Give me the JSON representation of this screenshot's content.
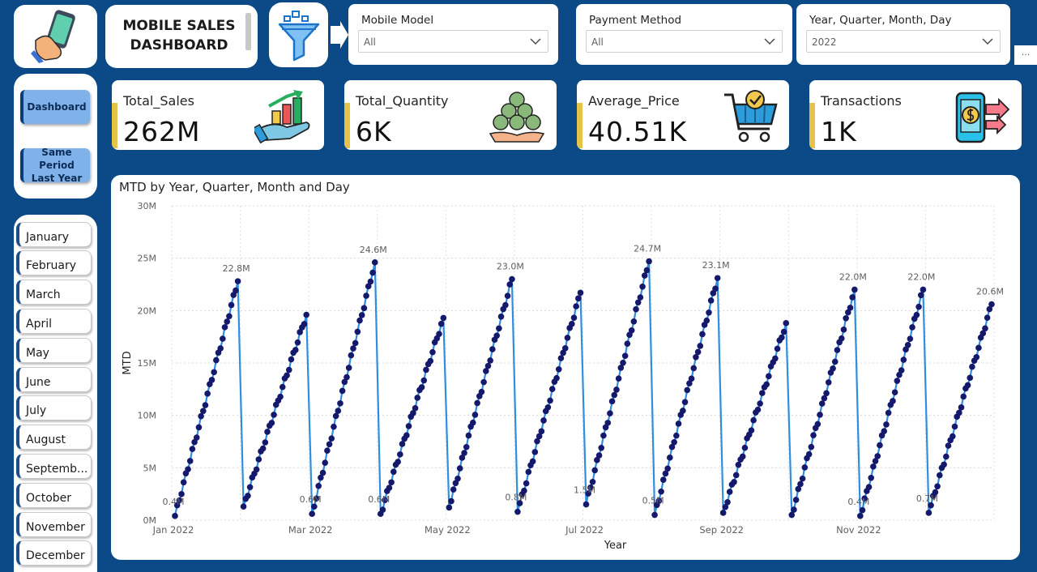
{
  "header": {
    "title_line1": "MOBILE SALES",
    "title_line2": "DASHBOARD"
  },
  "filters": [
    {
      "label": "Mobile Model",
      "value": "All"
    },
    {
      "label": "Payment Method",
      "value": "All"
    },
    {
      "label": "Year, Quarter, Month, Day",
      "value": "2022"
    }
  ],
  "more_label": "...",
  "nav": {
    "dashboard": "Dashboard",
    "same_period_line1": "Same Period",
    "same_period_line2": "Last Year"
  },
  "months": [
    "January",
    "February",
    "March",
    "April",
    "May",
    "June",
    "July",
    "August",
    "Septemb...",
    "October",
    "November",
    "December"
  ],
  "kpis": [
    {
      "name": "Total_Sales",
      "value": "262M"
    },
    {
      "name": "Total_Quantity",
      "value": "6K"
    },
    {
      "name": "Average_Price",
      "value": "40.51K"
    },
    {
      "name": "Transactions",
      "value": "1K"
    }
  ],
  "colors": {
    "accent": "#e5c24a",
    "line": "#2f8ee0",
    "marker": "#14196b",
    "nav_button": "#7fb2ea",
    "background": "#0b4a86"
  },
  "chart_data": {
    "type": "line",
    "title": "MTD by Year, Quarter, Month and Day",
    "xlabel": "Year",
    "ylabel": "MTD",
    "ylim": [
      0,
      30
    ],
    "y_ticks": [
      "0M",
      "5M",
      "10M",
      "15M",
      "20M",
      "25M",
      "30M"
    ],
    "x_ticks": [
      "Jan 2022",
      "Mar 2022",
      "May 2022",
      "Jul 2022",
      "Sep 2022",
      "Nov 2022"
    ],
    "grid": true,
    "series": [
      {
        "months": [
          {
            "month": "Jan",
            "start": 0.4,
            "end": 22.8,
            "start_label": "0.4M",
            "end_label": "22.8M"
          },
          {
            "month": "Feb",
            "start": 1.3,
            "end": 19.6,
            "start_label": "",
            "end_label": ""
          },
          {
            "month": "Mar",
            "start": 0.6,
            "end": 24.6,
            "start_label": "0.6M",
            "end_label": "24.6M"
          },
          {
            "month": "Apr",
            "start": 0.6,
            "end": 19.3,
            "start_label": "0.6M",
            "end_label": ""
          },
          {
            "month": "May",
            "start": 1.2,
            "end": 23.0,
            "start_label": "",
            "end_label": "23.0M"
          },
          {
            "month": "Jun",
            "start": 0.8,
            "end": 21.7,
            "start_label": "0.8M",
            "end_label": ""
          },
          {
            "month": "Jul",
            "start": 1.5,
            "end": 24.7,
            "start_label": "1.5M",
            "end_label": "24.7M"
          },
          {
            "month": "Aug",
            "start": 0.5,
            "end": 23.1,
            "start_label": "0.5M",
            "end_label": "23.1M"
          },
          {
            "month": "Sep",
            "start": 0.7,
            "end": 18.8,
            "start_label": "",
            "end_label": ""
          },
          {
            "month": "Oct",
            "start": 0.5,
            "end": 22.0,
            "start_label": "",
            "end_label": "22.0M"
          },
          {
            "month": "Nov",
            "start": 0.4,
            "end": 22.0,
            "start_label": "0.4M",
            "end_label": "22.0M"
          },
          {
            "month": "Dec",
            "start": 0.7,
            "end": 20.6,
            "start_label": "0.7M",
            "end_label": "20.6M"
          }
        ]
      }
    ]
  }
}
